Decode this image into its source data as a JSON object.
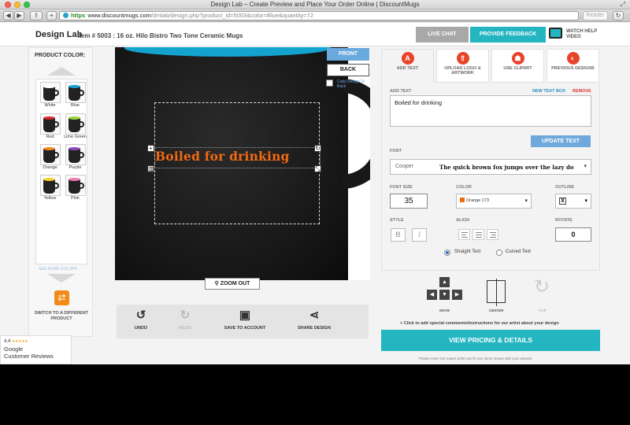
{
  "window": {
    "title": "Design Lab – Create Preview and Place Your Order Online | DiscountMugs"
  },
  "toolbar": {
    "back": "◀",
    "forward": "▶",
    "share": "⇪",
    "add_tab": "+",
    "address_scheme": "https",
    "address_host": "www.discountmugs.com",
    "address_path": "/dmlab/design.php?product_id=5003&color=Blue&quantity=72",
    "reader": "Reader"
  },
  "header": {
    "page_title": "Design Lab",
    "item_title": "Item # 5003 : 16 oz. Hilo Bistro Two Tone Ceramic Mugs",
    "live_chat": "LIVE CHAT",
    "feedback": "PROVIDE FEEDBACK",
    "watch_video": "WATCH HELP VIDEO"
  },
  "left_panel": {
    "label": "PRODUCT COLOR:",
    "colors": [
      {
        "name": "White",
        "rim": "#ffffff"
      },
      {
        "name": "Blue",
        "rim": "#14a3cf"
      },
      {
        "name": "Red",
        "rim": "#d42a2a"
      },
      {
        "name": "Lime Green",
        "rim": "#9bd43a"
      },
      {
        "name": "Orange",
        "rim": "#f08a1c"
      },
      {
        "name": "Purple",
        "rim": "#8a4ab8"
      },
      {
        "name": "Yellow",
        "rim": "#f3d22a"
      },
      {
        "name": "Pink",
        "rim": "#ec7ab0"
      }
    ],
    "see_more": "SEE MORE COLORS",
    "switch_label": "SWITCH TO A DIFFERENT PRODUCT"
  },
  "canvas": {
    "design_text": "Boiled for drinking",
    "text_color": "#f26a12",
    "mug_rim_color": "#14a3cf",
    "front": "FRONT",
    "back": "BACK",
    "copy_design": "Copy Design To Back",
    "zoom_out": "ZOOM OUT"
  },
  "bottom_bar": {
    "undo": "UNDO",
    "redo": "REDO",
    "save": "SAVE TO ACCOUNT",
    "share": "SHARE DESIGN"
  },
  "tabs": [
    {
      "label": "ADD TEXT",
      "icon": "A"
    },
    {
      "label": "UPLOAD LOGO & ARTWORK",
      "icon": "⇧"
    },
    {
      "label": "USE CLIPART",
      "icon": "☗"
    },
    {
      "label": "PREVIOUS DESIGNS",
      "icon": "◐"
    }
  ],
  "text_panel": {
    "add_text_label": "ADD TEXT",
    "new_text_box": "NEW TEXT BOX",
    "remove": "REMOVE",
    "text_value": "Boiled for drinking",
    "update_text": "UPDATE TEXT",
    "font_label": "FONT",
    "font_name": "Cooper",
    "font_preview": "The quick brown fox jumps over the lazy do",
    "font_size_label": "FONT SIZE",
    "font_size": "35",
    "color_label": "COLOR",
    "color_value": "Orange 173",
    "outline_label": "OUTLINE",
    "outline_value": "X",
    "style_label": "STYLE",
    "bold": "B",
    "italic": "I",
    "align_label": "ALIGN",
    "rotate_label": "ROTATE",
    "rotate_value": "0",
    "straight_text": "Straight Text",
    "curved_text": "Curved Text"
  },
  "controls": {
    "move": "MOVE",
    "center": "CENTER",
    "flip": "FLIP",
    "comments": "+ Click to add special comments/instructions for our artist about your design",
    "pricing": "VIEW PRICING & DETAILS",
    "note": "Please note! Our expert artist can fix any minor issues with your artwork."
  },
  "google_badge": {
    "rating": "4.4",
    "stars": "★★★★★",
    "brand": "Google",
    "label": "Customer Reviews"
  }
}
